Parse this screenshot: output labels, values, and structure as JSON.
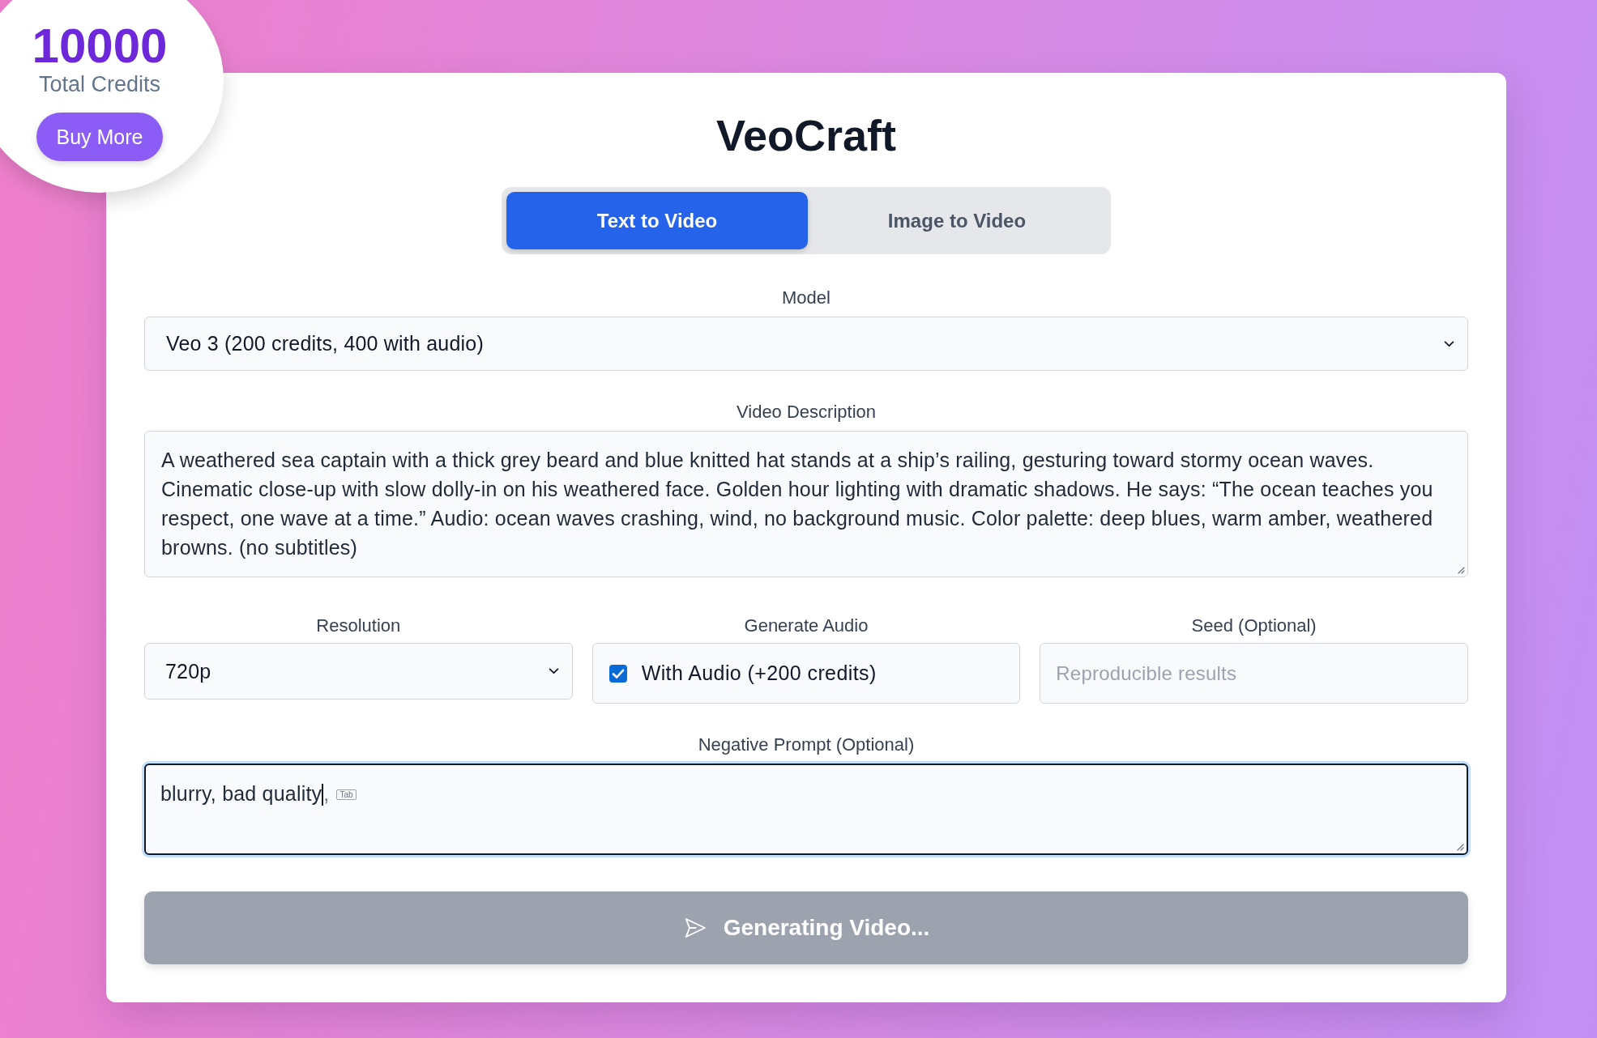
{
  "credits": {
    "amount": "10000",
    "label": "Total Credits",
    "button": "Buy More"
  },
  "app": {
    "title": "VeoCraft"
  },
  "tabs": [
    {
      "label": "Text to Video",
      "selected": true
    },
    {
      "label": "Image to Video",
      "selected": false
    }
  ],
  "form": {
    "model": {
      "label": "Model",
      "value": "Veo 3 (200 credits, 400 with audio)"
    },
    "description": {
      "label": "Video Description",
      "value": "A weathered sea captain with a thick grey beard and blue knitted hat stands at a ship’s railing, gesturing toward stormy ocean waves. Cinematic close-up with slow dolly-in on his weathered face. Golden hour lighting with dramatic shadows. He says: “The ocean teaches you respect, one wave at a time.” Audio: ocean waves crashing, wind, no background music. Color palette: deep blues, warm amber, weathered browns. (no subtitles)"
    },
    "resolution": {
      "label": "Resolution",
      "value": "720p"
    },
    "audio": {
      "label": "Generate Audio",
      "option": "With Audio (+200 credits)",
      "checked": true
    },
    "seed": {
      "label": "Seed (Optional)",
      "placeholder": "Reproducible results"
    },
    "negative_prompt": {
      "label": "Negative Prompt (Optional)",
      "value": "blurry, bad quality",
      "focused": true,
      "suggestion": ",",
      "suggestion_key": "Tab"
    }
  },
  "submit": {
    "label": "Generating Video...",
    "disabled": true
  }
}
